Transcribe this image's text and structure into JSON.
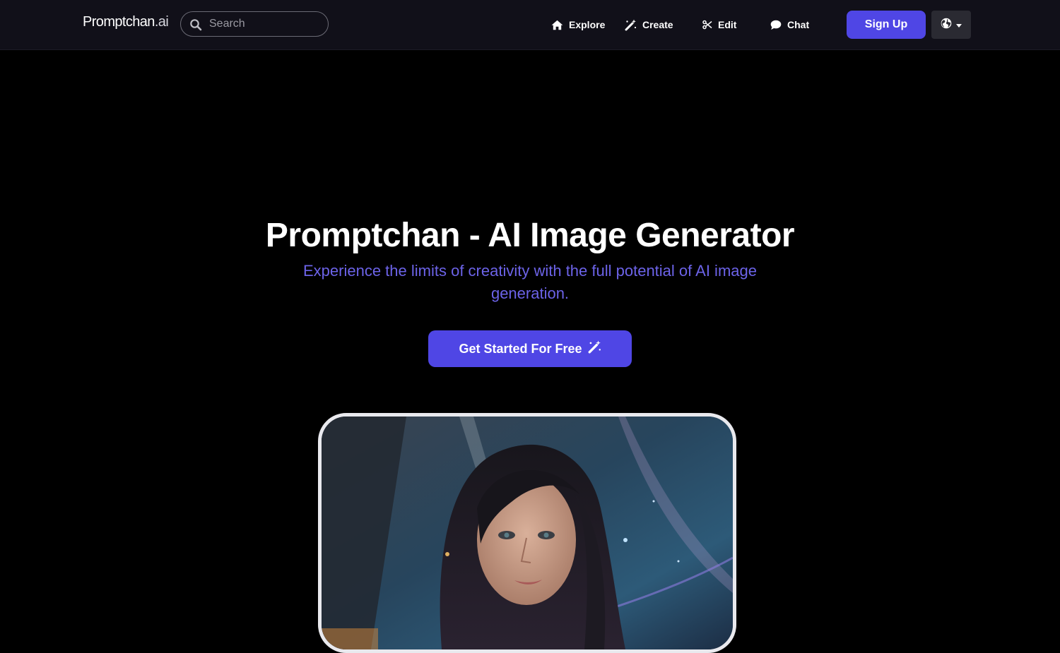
{
  "nav": {
    "logo_main": "Promptchan",
    "logo_tld": ".ai",
    "search": {
      "placeholder": "Search",
      "value": ""
    },
    "items": [
      {
        "label": "Explore",
        "icon": "home-icon"
      },
      {
        "label": "Create",
        "icon": "magic-wand-icon"
      },
      {
        "label": "Edit",
        "icon": "scissors-icon"
      },
      {
        "label": "Chat",
        "icon": "chat-bubble-icon"
      }
    ],
    "signup_label": "Sign Up",
    "language_icon": "globe-icon"
  },
  "hero": {
    "title": "Promptchan - AI Image Generator",
    "subtitle": "Experience the limits of creativity with the full potential of AI image generation.",
    "cta_label": "Get Started For Free",
    "cta_icon": "magic-wand-icon"
  },
  "colors": {
    "accent": "#4f46e5",
    "subtitle": "#6c63e8",
    "navbar_bg": "#111019",
    "page_bg": "#000000"
  }
}
